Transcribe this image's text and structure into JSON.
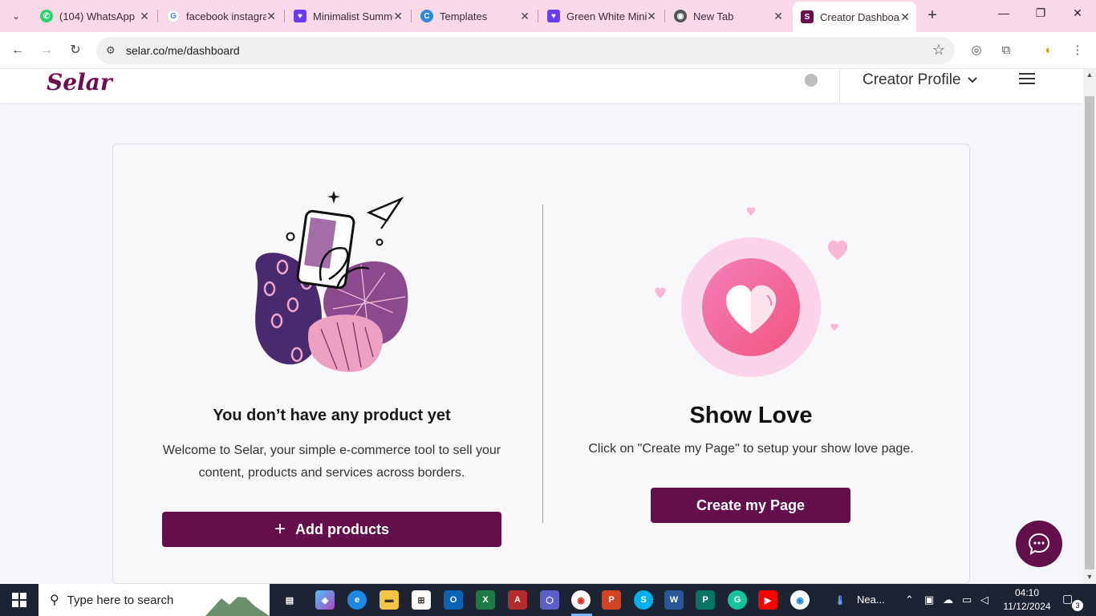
{
  "browser": {
    "tabs": [
      {
        "title": "(104) WhatsApp",
        "icon": "whatsapp-icon",
        "color": "#25d366"
      },
      {
        "title": "facebook instagram",
        "icon": "google-icon",
        "color": "#4285f4"
      },
      {
        "title": "Minimalist Summer",
        "icon": "heart-shield-icon",
        "color": "#6a3cf0"
      },
      {
        "title": "Templates",
        "icon": "canva-icon",
        "color": "#2a8bd6"
      },
      {
        "title": "Green White Minimalist",
        "icon": "heart-shield-icon",
        "color": "#6a3cf0"
      },
      {
        "title": "New Tab",
        "icon": "chrome-icon",
        "color": "#555555"
      },
      {
        "title": "Creator Dashboard",
        "icon": "selar-icon",
        "color": "#6b0f4f"
      }
    ],
    "url": "selar.co/me/dashboard"
  },
  "header": {
    "logo": "Selar",
    "profile_label": "Creator Profile"
  },
  "products": {
    "title": "You don’t have any product yet",
    "description": "Welcome to Selar, your simple e-commerce tool to sell your content, products and services across borders.",
    "button_plus": "+",
    "button_label": "Add products"
  },
  "show_love": {
    "title": "Show Love",
    "description": "Click on \"Create my Page\" to setup your show love page.",
    "button_label": "Create my Page"
  },
  "taskbar": {
    "search_placeholder": "Type here to search",
    "weather_text": "Nea...",
    "time": "04:10",
    "date": "11/12/2024",
    "notification_count": "3"
  },
  "colors": {
    "brand": "#620f4c",
    "tabstrip": "#f9d9e8",
    "heart_pink": "#f7649b"
  }
}
